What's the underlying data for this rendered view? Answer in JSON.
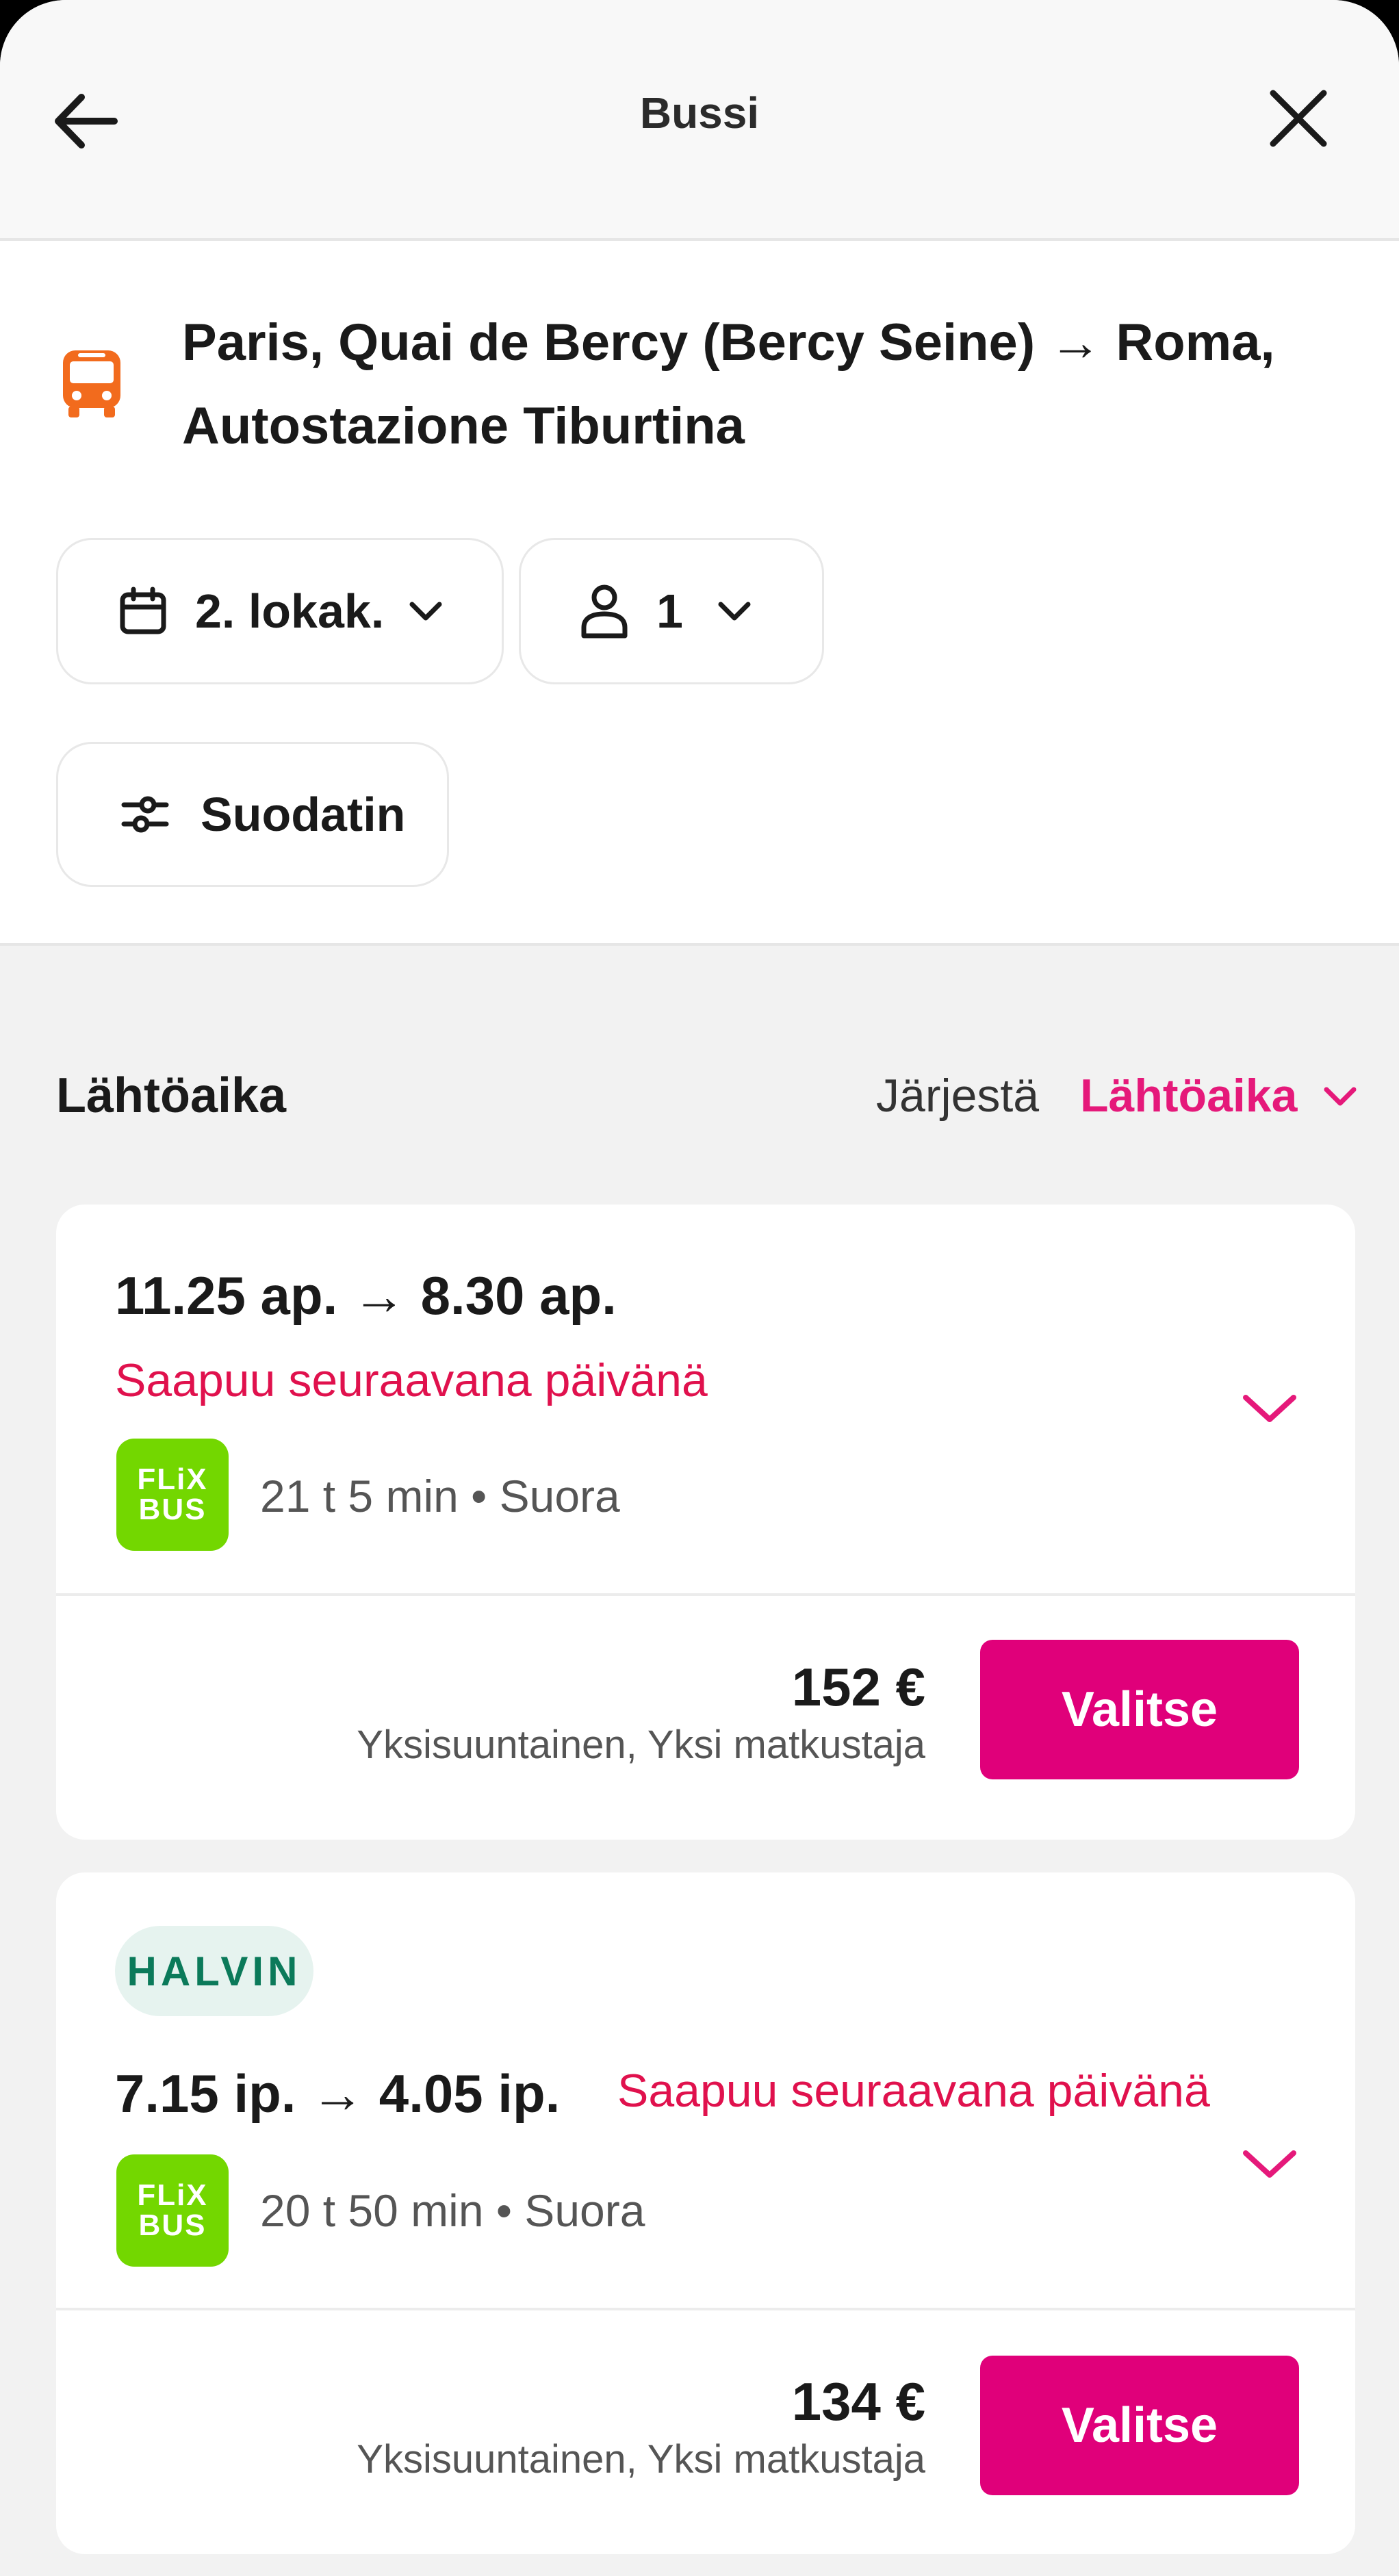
{
  "header": {
    "title": "Bussi"
  },
  "route": {
    "text": "Paris, Quai de Bercy (Bercy Seine) → Roma, Autostazione Tiburtina"
  },
  "filters": {
    "date": "2. lokak.",
    "passengers": "1",
    "filter_label": "Suodatin"
  },
  "results": {
    "section_title": "Lähtöaika",
    "sort_label": "Järjestä",
    "sort_value": "Lähtöaika"
  },
  "trips": [
    {
      "times": "11.25 ap.  →  8.30 ap.",
      "arrival_note": "Saapuu seuraavana päivänä",
      "operator_logo": {
        "line1": "FLiX",
        "line2": "BUS"
      },
      "duration": "21 t 5 min • Suora",
      "price": "152 €",
      "price_note": "Yksisuuntainen, Yksi matkustaja",
      "button": "Valitse"
    },
    {
      "badge": "HALVIN",
      "times": "7.15 ip.  →  4.05 ip.",
      "arrival_note": "Saapuu seuraavana päivänä",
      "operator_logo": {
        "line1": "FLiX",
        "line2": "BUS"
      },
      "duration": "20 t 50 min • Suora",
      "price": "134 €",
      "price_note": "Yksisuuntainen, Yksi matkustaja",
      "button": "Valitse"
    }
  ],
  "colors": {
    "accent": "#e0007a",
    "accent_text": "#e5197a",
    "warning_text": "#e0114d",
    "bus_icon": "#f26b1d",
    "flixbus_green": "#73d700",
    "badge_bg": "#e6f3ef",
    "badge_text": "#0b7a5a"
  },
  "icons": {
    "back": "arrow-left-icon",
    "close": "close-icon",
    "bus": "bus-icon",
    "calendar": "calendar-icon",
    "person": "person-icon",
    "chevron": "chevron-down-icon",
    "filter": "sliders-icon"
  }
}
